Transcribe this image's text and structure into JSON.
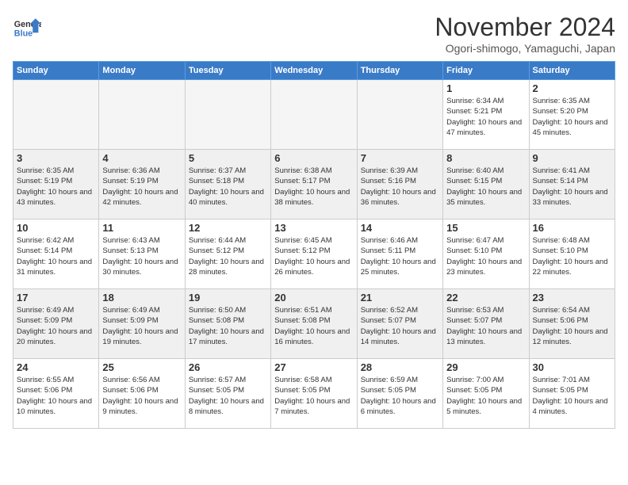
{
  "header": {
    "logo_line1": "General",
    "logo_line2": "Blue",
    "month": "November 2024",
    "location": "Ogori-shimogo, Yamaguchi, Japan"
  },
  "weekdays": [
    "Sunday",
    "Monday",
    "Tuesday",
    "Wednesday",
    "Thursday",
    "Friday",
    "Saturday"
  ],
  "weeks": [
    [
      {
        "day": "",
        "info": ""
      },
      {
        "day": "",
        "info": ""
      },
      {
        "day": "",
        "info": ""
      },
      {
        "day": "",
        "info": ""
      },
      {
        "day": "",
        "info": ""
      },
      {
        "day": "1",
        "info": "Sunrise: 6:34 AM\nSunset: 5:21 PM\nDaylight: 10 hours and 47 minutes."
      },
      {
        "day": "2",
        "info": "Sunrise: 6:35 AM\nSunset: 5:20 PM\nDaylight: 10 hours and 45 minutes."
      }
    ],
    [
      {
        "day": "3",
        "info": "Sunrise: 6:35 AM\nSunset: 5:19 PM\nDaylight: 10 hours and 43 minutes."
      },
      {
        "day": "4",
        "info": "Sunrise: 6:36 AM\nSunset: 5:19 PM\nDaylight: 10 hours and 42 minutes."
      },
      {
        "day": "5",
        "info": "Sunrise: 6:37 AM\nSunset: 5:18 PM\nDaylight: 10 hours and 40 minutes."
      },
      {
        "day": "6",
        "info": "Sunrise: 6:38 AM\nSunset: 5:17 PM\nDaylight: 10 hours and 38 minutes."
      },
      {
        "day": "7",
        "info": "Sunrise: 6:39 AM\nSunset: 5:16 PM\nDaylight: 10 hours and 36 minutes."
      },
      {
        "day": "8",
        "info": "Sunrise: 6:40 AM\nSunset: 5:15 PM\nDaylight: 10 hours and 35 minutes."
      },
      {
        "day": "9",
        "info": "Sunrise: 6:41 AM\nSunset: 5:14 PM\nDaylight: 10 hours and 33 minutes."
      }
    ],
    [
      {
        "day": "10",
        "info": "Sunrise: 6:42 AM\nSunset: 5:14 PM\nDaylight: 10 hours and 31 minutes."
      },
      {
        "day": "11",
        "info": "Sunrise: 6:43 AM\nSunset: 5:13 PM\nDaylight: 10 hours and 30 minutes."
      },
      {
        "day": "12",
        "info": "Sunrise: 6:44 AM\nSunset: 5:12 PM\nDaylight: 10 hours and 28 minutes."
      },
      {
        "day": "13",
        "info": "Sunrise: 6:45 AM\nSunset: 5:12 PM\nDaylight: 10 hours and 26 minutes."
      },
      {
        "day": "14",
        "info": "Sunrise: 6:46 AM\nSunset: 5:11 PM\nDaylight: 10 hours and 25 minutes."
      },
      {
        "day": "15",
        "info": "Sunrise: 6:47 AM\nSunset: 5:10 PM\nDaylight: 10 hours and 23 minutes."
      },
      {
        "day": "16",
        "info": "Sunrise: 6:48 AM\nSunset: 5:10 PM\nDaylight: 10 hours and 22 minutes."
      }
    ],
    [
      {
        "day": "17",
        "info": "Sunrise: 6:49 AM\nSunset: 5:09 PM\nDaylight: 10 hours and 20 minutes."
      },
      {
        "day": "18",
        "info": "Sunrise: 6:49 AM\nSunset: 5:09 PM\nDaylight: 10 hours and 19 minutes."
      },
      {
        "day": "19",
        "info": "Sunrise: 6:50 AM\nSunset: 5:08 PM\nDaylight: 10 hours and 17 minutes."
      },
      {
        "day": "20",
        "info": "Sunrise: 6:51 AM\nSunset: 5:08 PM\nDaylight: 10 hours and 16 minutes."
      },
      {
        "day": "21",
        "info": "Sunrise: 6:52 AM\nSunset: 5:07 PM\nDaylight: 10 hours and 14 minutes."
      },
      {
        "day": "22",
        "info": "Sunrise: 6:53 AM\nSunset: 5:07 PM\nDaylight: 10 hours and 13 minutes."
      },
      {
        "day": "23",
        "info": "Sunrise: 6:54 AM\nSunset: 5:06 PM\nDaylight: 10 hours and 12 minutes."
      }
    ],
    [
      {
        "day": "24",
        "info": "Sunrise: 6:55 AM\nSunset: 5:06 PM\nDaylight: 10 hours and 10 minutes."
      },
      {
        "day": "25",
        "info": "Sunrise: 6:56 AM\nSunset: 5:06 PM\nDaylight: 10 hours and 9 minutes."
      },
      {
        "day": "26",
        "info": "Sunrise: 6:57 AM\nSunset: 5:05 PM\nDaylight: 10 hours and 8 minutes."
      },
      {
        "day": "27",
        "info": "Sunrise: 6:58 AM\nSunset: 5:05 PM\nDaylight: 10 hours and 7 minutes."
      },
      {
        "day": "28",
        "info": "Sunrise: 6:59 AM\nSunset: 5:05 PM\nDaylight: 10 hours and 6 minutes."
      },
      {
        "day": "29",
        "info": "Sunrise: 7:00 AM\nSunset: 5:05 PM\nDaylight: 10 hours and 5 minutes."
      },
      {
        "day": "30",
        "info": "Sunrise: 7:01 AM\nSunset: 5:05 PM\nDaylight: 10 hours and 4 minutes."
      }
    ]
  ]
}
